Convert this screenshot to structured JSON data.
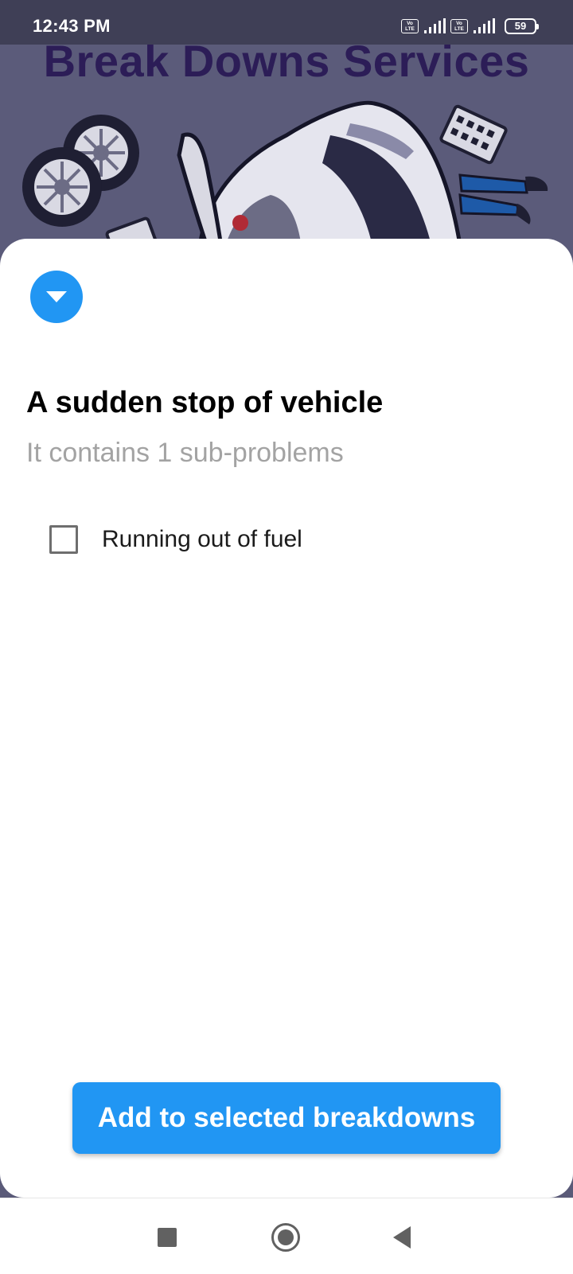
{
  "status_bar": {
    "time": "12:43 PM",
    "battery_level": "59",
    "network_label_top": "Vo",
    "network_label_bottom": "LTE"
  },
  "header": {
    "title": "Break Downs Services"
  },
  "sheet": {
    "problem_title": "A sudden stop of vehicle",
    "problem_subtitle": "It contains 1 sub-problems",
    "subproblems": [
      {
        "label": "Running out of fuel",
        "checked": false
      }
    ],
    "add_button_label": "Add to selected breakdowns"
  },
  "colors": {
    "accent": "#2196f3",
    "banner": "#5b5b7a",
    "title_text": "#2c1d57"
  },
  "icons": {
    "collapse": "caret-down-icon",
    "nav_recents": "square-icon",
    "nav_home": "circle-icon",
    "nav_back": "triangle-back-icon"
  }
}
